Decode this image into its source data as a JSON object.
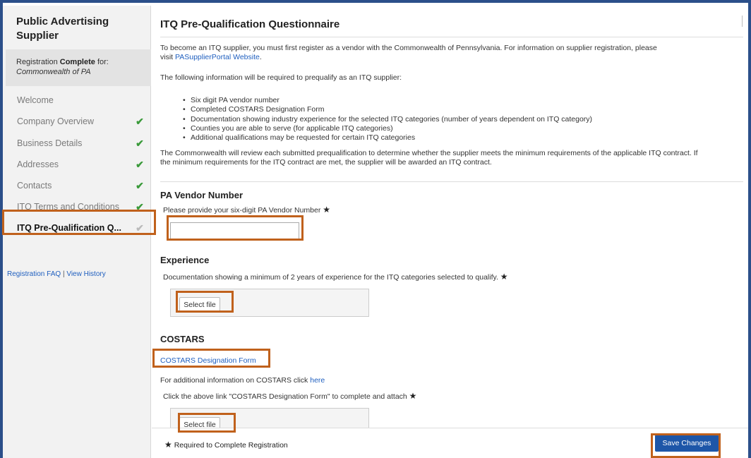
{
  "sidebar": {
    "title": "Public Advertising Supplier",
    "registration_prefix": "Registration ",
    "registration_status": "Complete",
    "registration_suffix": " for:",
    "entity": "Commonwealth of PA",
    "items": [
      {
        "label": "Welcome",
        "check": ""
      },
      {
        "label": "Company Overview",
        "check": "✔"
      },
      {
        "label": "Business Details",
        "check": "✔"
      },
      {
        "label": "Addresses",
        "check": "✔"
      },
      {
        "label": "Contacts",
        "check": "✔"
      },
      {
        "label": "ITQ Terms and Conditions",
        "check": "✔"
      },
      {
        "label": "ITQ Pre-Qualification Q...",
        "check": "✔"
      }
    ],
    "faq_link": "Registration FAQ",
    "separator": "|",
    "history_link": "View History"
  },
  "main": {
    "title": "ITQ Pre-Qualification Questionnaire",
    "intro_line1": "To become an ITQ supplier, you must first register as a vendor with the Commonwealth of Pennsylvania. For information on supplier registration, please",
    "intro_visit": "visit ",
    "intro_link": "PASupplierPortal Website",
    "intro_end": ".",
    "required_intro": "The following information will be required to prequalify as an ITQ supplier:",
    "bullets": [
      "Six digit PA vendor number",
      "Completed COSTARS Designation Form",
      "Documentation showing industry experience for the selected ITQ categories (number of years dependent on ITQ category)",
      "Counties you are able to serve (for applicable ITQ categories)",
      "Additional qualifications may be requested for certain ITQ categories"
    ],
    "review_line1": "The Commonwealth will review each submitted prequalification to determine whether the supplier meets the minimum requirements of the applicable ITQ contract. If",
    "review_line2": "the minimum requirements for the ITQ contract are met, the supplier will be awarded an ITQ contract.",
    "vendor": {
      "heading": "PA Vendor Number",
      "prompt": "Please provide your six-digit PA Vendor Number",
      "value": ""
    },
    "experience": {
      "heading": "Experience",
      "prompt": "Documentation showing a minimum of 2 years of experience for the ITQ categories selected to qualify.",
      "button": "Select file"
    },
    "costars": {
      "heading": "COSTARS",
      "form_link": "COSTARS Designation Form",
      "additional": "For additional information on COSTARS click ",
      "here_link": "here",
      "attach_prompt": "Click the above link \"COSTARS Designation Form\" to complete and attach",
      "button": "Select file"
    },
    "required_star": "★"
  },
  "footer": {
    "required_note": "Required to Complete Registration",
    "save_label": "Save Changes"
  },
  "colors": {
    "accent_blue": "#1d56a8",
    "link_blue": "#1f5fbf",
    "check_green": "#3a9a3a",
    "callout_orange": "#c0611c",
    "page_border": "#2b4f8a"
  }
}
